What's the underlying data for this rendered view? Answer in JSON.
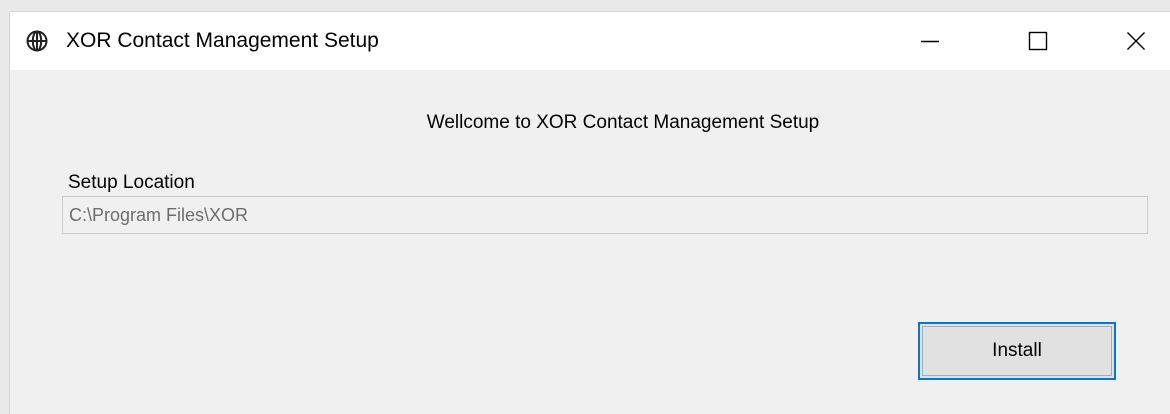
{
  "window": {
    "title": "XOR Contact Management Setup",
    "icon": "globe-icon"
  },
  "caption_buttons": {
    "minimize": "minimize-icon",
    "maximize": "maximize-icon",
    "close": "close-icon"
  },
  "content": {
    "welcome": "Wellcome to XOR Contact Management Setup",
    "setup_location_label": "Setup Location",
    "setup_location_value": "C:\\Program Files\\XOR",
    "install_label": "Install"
  },
  "colors": {
    "accent": "#0078d7",
    "background": "#f0f0f0",
    "titlebar": "#ffffff"
  }
}
